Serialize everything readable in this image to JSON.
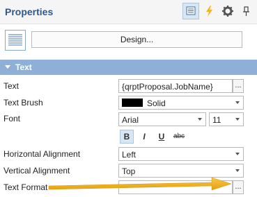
{
  "panel": {
    "title": "Properties"
  },
  "toolbar": {
    "categorized_icon": "list-view-icon",
    "events_icon": "lightning-icon",
    "settings_icon": "gear-icon",
    "pin_icon": "pin-icon"
  },
  "design": {
    "button_label": "Design..."
  },
  "section": {
    "label": "Text"
  },
  "rows": {
    "text": {
      "label": "Text",
      "value": "{qrptProposal.JobName}",
      "ellipsis": "..."
    },
    "text_brush": {
      "label": "Text Brush",
      "value": "Solid"
    },
    "font": {
      "label": "Font",
      "family": "Arial",
      "size": "11"
    },
    "font_style": {
      "bold": "B",
      "italic": "I",
      "underline": "U",
      "strike": "abc"
    },
    "horizontal_alignment": {
      "label": "Horizontal Alignment",
      "value": "Left"
    },
    "vertical_alignment": {
      "label": "Vertical Alignment",
      "value": "Top"
    },
    "text_format": {
      "label": "Text Format",
      "value": "",
      "ellipsis": "..."
    }
  },
  "colors": {
    "accent": "#2a5a8c",
    "section_bg": "#8fb0d6",
    "annotation_arrow": "#f2b21d"
  }
}
